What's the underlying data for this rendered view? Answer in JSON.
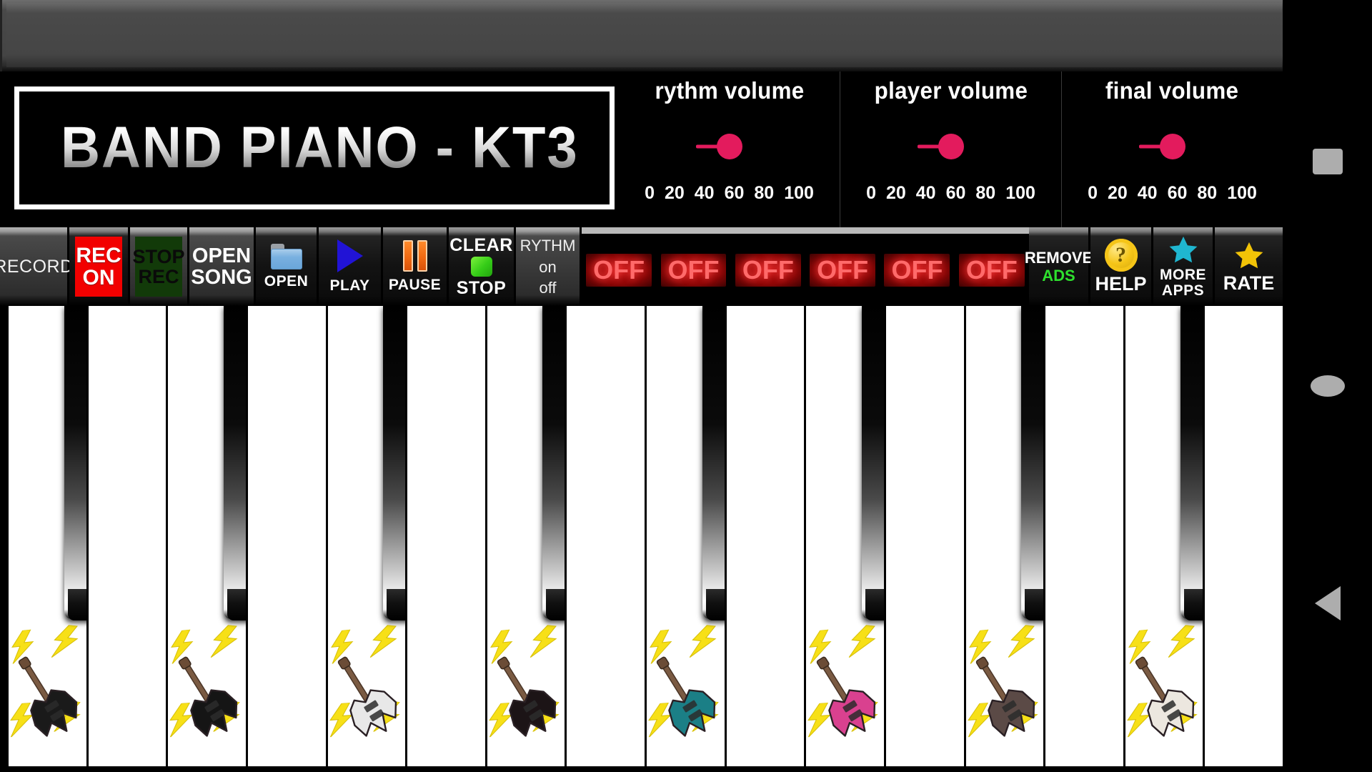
{
  "app": {
    "title": "BAND PIANO - KT3"
  },
  "ad_banner": {
    "label": ""
  },
  "volumes": [
    {
      "name": "rythm-volume",
      "title": "rythm volume",
      "value": 50,
      "ticks": [
        "0",
        "20",
        "40",
        "60",
        "80",
        "100"
      ],
      "color": "#e31b5d"
    },
    {
      "name": "player-volume",
      "title": "player volume",
      "value": 50,
      "ticks": [
        "0",
        "20",
        "40",
        "60",
        "80",
        "100"
      ],
      "color": "#e31b5d"
    },
    {
      "name": "final-volume",
      "title": "final volume",
      "value": 50,
      "ticks": [
        "0",
        "20",
        "40",
        "60",
        "80",
        "100"
      ],
      "color": "#e31b5d"
    }
  ],
  "toolbar": {
    "record_label": "RECORD",
    "rec_on": {
      "line1": "REC",
      "line2": "ON"
    },
    "stop_rec": {
      "line1": "STOP",
      "line2": "REC"
    },
    "open_song": {
      "line1": "OPEN",
      "line2": "SONG"
    },
    "open": {
      "label": "OPEN",
      "icon": "folder-icon"
    },
    "play": {
      "label": "PLAY",
      "icon": "play-icon"
    },
    "pause": {
      "label": "PAUSE",
      "icon": "pause-icon"
    },
    "clear_stop": {
      "line1": "CLEAR",
      "line2": "STOP",
      "icon": "green-square-icon"
    },
    "rythm": {
      "line1": "RYTHM",
      "line2": "on",
      "line3": "off"
    },
    "off_buttons": [
      "OFF",
      "OFF",
      "OFF",
      "OFF",
      "OFF",
      "OFF"
    ],
    "remove_ads": {
      "line1": "REMOVE",
      "line2": "ADS"
    },
    "help": {
      "label": "HELP",
      "icon": "question-mark-icon",
      "glyph": "?"
    },
    "more_apps": {
      "line1": "MORE",
      "line2": "APPS",
      "icon": "star-icon",
      "color": "#1fb6d0"
    },
    "rate": {
      "label": "RATE",
      "icon": "star-icon",
      "color": "#f2c307"
    }
  },
  "keyboard": {
    "white_key_count": 16,
    "black_key_count": 8,
    "keys": [
      {
        "name": "white-key-1",
        "guitar": "black-flying-v-guitar",
        "guitar_color": "#1a1a1a"
      },
      {
        "name": "white-key-2",
        "guitar": "none",
        "guitar_color": ""
      },
      {
        "name": "white-key-3",
        "guitar": "black-warlock-guitar",
        "guitar_color": "#151515"
      },
      {
        "name": "white-key-4",
        "guitar": "none",
        "guitar_color": ""
      },
      {
        "name": "white-key-5",
        "guitar": "white-flying-v-guitar",
        "guitar_color": "#e8e8e8"
      },
      {
        "name": "white-key-6",
        "guitar": "none",
        "guitar_color": ""
      },
      {
        "name": "white-key-7",
        "guitar": "black-red-trim-guitar",
        "guitar_color": "#1c1416"
      },
      {
        "name": "white-key-8",
        "guitar": "none",
        "guitar_color": ""
      },
      {
        "name": "white-key-9",
        "guitar": "teal-guitar",
        "guitar_color": "#1b7f86"
      },
      {
        "name": "white-key-10",
        "guitar": "none",
        "guitar_color": ""
      },
      {
        "name": "white-key-11",
        "guitar": "pink-guitar",
        "guitar_color": "#d9418f"
      },
      {
        "name": "white-key-12",
        "guitar": "none",
        "guitar_color": ""
      },
      {
        "name": "white-key-13",
        "guitar": "brown-explorer-guitar",
        "guitar_color": "#5b4a46"
      },
      {
        "name": "white-key-14",
        "guitar": "none",
        "guitar_color": ""
      },
      {
        "name": "white-key-15",
        "guitar": "cream-guitar",
        "guitar_color": "#ece7df"
      },
      {
        "name": "white-key-16",
        "guitar": "none",
        "guitar_color": ""
      }
    ],
    "bolt_color": "#f7e017"
  },
  "navbar": {
    "recents": "recents-button",
    "home": "home-button",
    "back": "back-button"
  }
}
